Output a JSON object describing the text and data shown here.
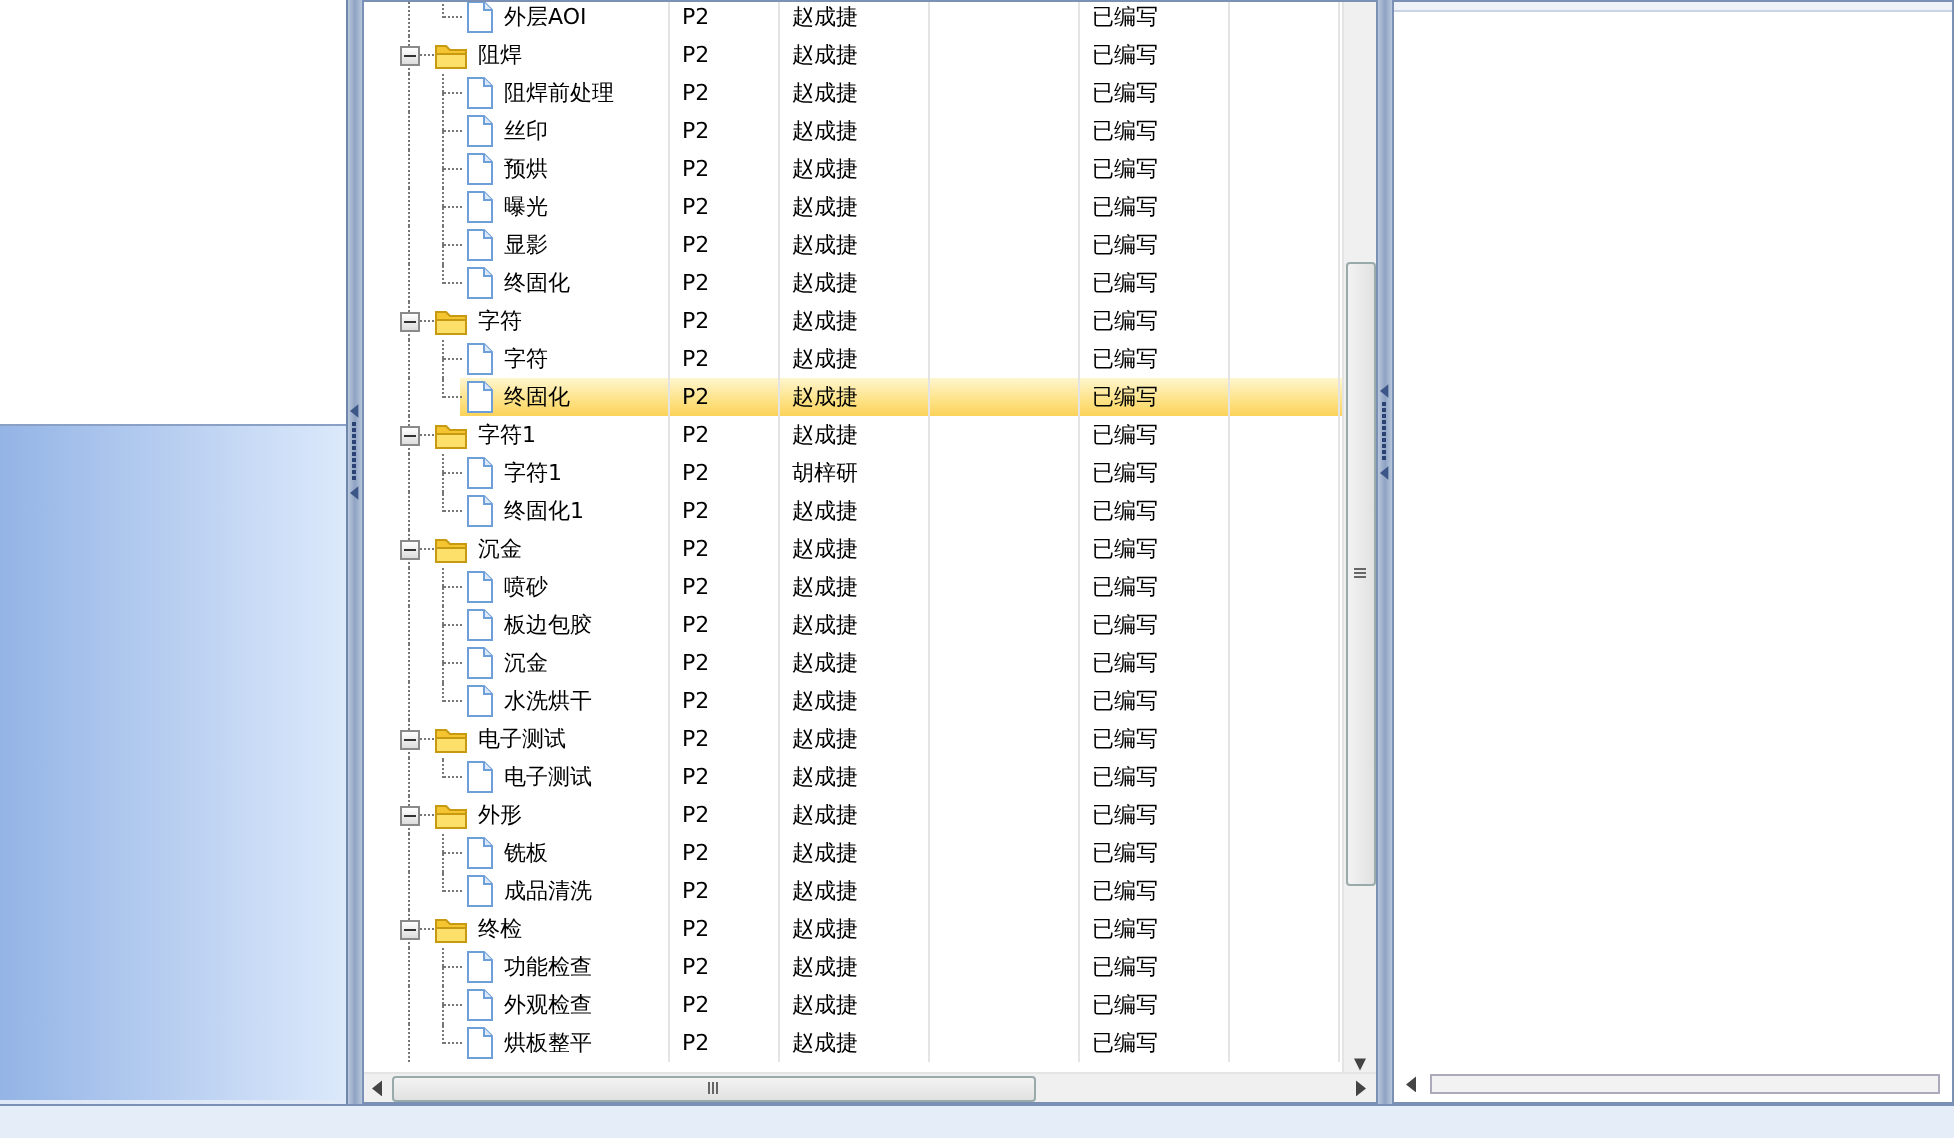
{
  "tree": {
    "nodes": [
      {
        "children": [
          {
            "label": "外层AOI",
            "kind": "file",
            "selected": false,
            "cells": [
              "P2",
              "赵成捷",
              "已编写"
            ]
          }
        ]
      },
      {
        "label": "阻焊",
        "kind": "folder",
        "expanded": true,
        "selected": false,
        "cells": [
          "P2",
          "赵成捷",
          "已编写"
        ],
        "children": [
          {
            "label": "阻焊前处理",
            "kind": "file",
            "selected": false,
            "cells": [
              "P2",
              "赵成捷",
              "已编写"
            ]
          },
          {
            "label": "丝印",
            "kind": "file",
            "selected": false,
            "cells": [
              "P2",
              "赵成捷",
              "已编写"
            ]
          },
          {
            "label": "预烘",
            "kind": "file",
            "selected": false,
            "cells": [
              "P2",
              "赵成捷",
              "已编写"
            ]
          },
          {
            "label": "曝光",
            "kind": "file",
            "selected": false,
            "cells": [
              "P2",
              "赵成捷",
              "已编写"
            ]
          },
          {
            "label": "显影",
            "kind": "file",
            "selected": false,
            "cells": [
              "P2",
              "赵成捷",
              "已编写"
            ]
          },
          {
            "label": "终固化",
            "kind": "file",
            "selected": false,
            "cells": [
              "P2",
              "赵成捷",
              "已编写"
            ]
          }
        ]
      },
      {
        "label": "字符",
        "kind": "folder",
        "expanded": true,
        "selected": false,
        "cells": [
          "P2",
          "赵成捷",
          "已编写"
        ],
        "children": [
          {
            "label": "字符",
            "kind": "file",
            "selected": false,
            "cells": [
              "P2",
              "赵成捷",
              "已编写"
            ]
          },
          {
            "label": "终固化",
            "kind": "file",
            "selected": true,
            "cells": [
              "P2",
              "赵成捷",
              "已编写"
            ]
          }
        ]
      },
      {
        "label": "字符1",
        "kind": "folder",
        "expanded": true,
        "selected": false,
        "cells": [
          "P2",
          "赵成捷",
          "已编写"
        ],
        "children": [
          {
            "label": "字符1",
            "kind": "file",
            "selected": false,
            "cells": [
              "P2",
              "胡梓研",
              "已编写"
            ]
          },
          {
            "label": "终固化1",
            "kind": "file",
            "selected": false,
            "cells": [
              "P2",
              "赵成捷",
              "已编写"
            ]
          }
        ]
      },
      {
        "label": "沉金",
        "kind": "folder",
        "expanded": true,
        "selected": false,
        "cells": [
          "P2",
          "赵成捷",
          "已编写"
        ],
        "children": [
          {
            "label": "喷砂",
            "kind": "file",
            "selected": false,
            "cells": [
              "P2",
              "赵成捷",
              "已编写"
            ]
          },
          {
            "label": "板边包胶",
            "kind": "file",
            "selected": false,
            "cells": [
              "P2",
              "赵成捷",
              "已编写"
            ]
          },
          {
            "label": "沉金",
            "kind": "file",
            "selected": false,
            "cells": [
              "P2",
              "赵成捷",
              "已编写"
            ]
          },
          {
            "label": "水洗烘干",
            "kind": "file",
            "selected": false,
            "cells": [
              "P2",
              "赵成捷",
              "已编写"
            ]
          }
        ]
      },
      {
        "label": "电子测试",
        "kind": "folder",
        "expanded": true,
        "selected": false,
        "cells": [
          "P2",
          "赵成捷",
          "已编写"
        ],
        "children": [
          {
            "label": "电子测试",
            "kind": "file",
            "selected": false,
            "cells": [
              "P2",
              "赵成捷",
              "已编写"
            ]
          }
        ]
      },
      {
        "label": "外形",
        "kind": "folder",
        "expanded": true,
        "selected": false,
        "cells": [
          "P2",
          "赵成捷",
          "已编写"
        ],
        "children": [
          {
            "label": "铣板",
            "kind": "file",
            "selected": false,
            "cells": [
              "P2",
              "赵成捷",
              "已编写"
            ]
          },
          {
            "label": "成品清洗",
            "kind": "file",
            "selected": false,
            "cells": [
              "P2",
              "赵成捷",
              "已编写"
            ]
          }
        ]
      },
      {
        "label": "终检",
        "kind": "folder",
        "expanded": true,
        "selected": false,
        "cells": [
          "P2",
          "赵成捷",
          "已编写"
        ],
        "children": [
          {
            "label": "功能检查",
            "kind": "file",
            "selected": false,
            "cells": [
              "P2",
              "赵成捷",
              "已编写"
            ]
          },
          {
            "label": "外观检查",
            "kind": "file",
            "selected": false,
            "cells": [
              "P2",
              "赵成捷",
              "已编写"
            ]
          },
          {
            "label": "烘板整平",
            "kind": "file",
            "selected": false,
            "cells": [
              "P2",
              "赵成捷",
              "已编写"
            ]
          }
        ]
      }
    ]
  }
}
